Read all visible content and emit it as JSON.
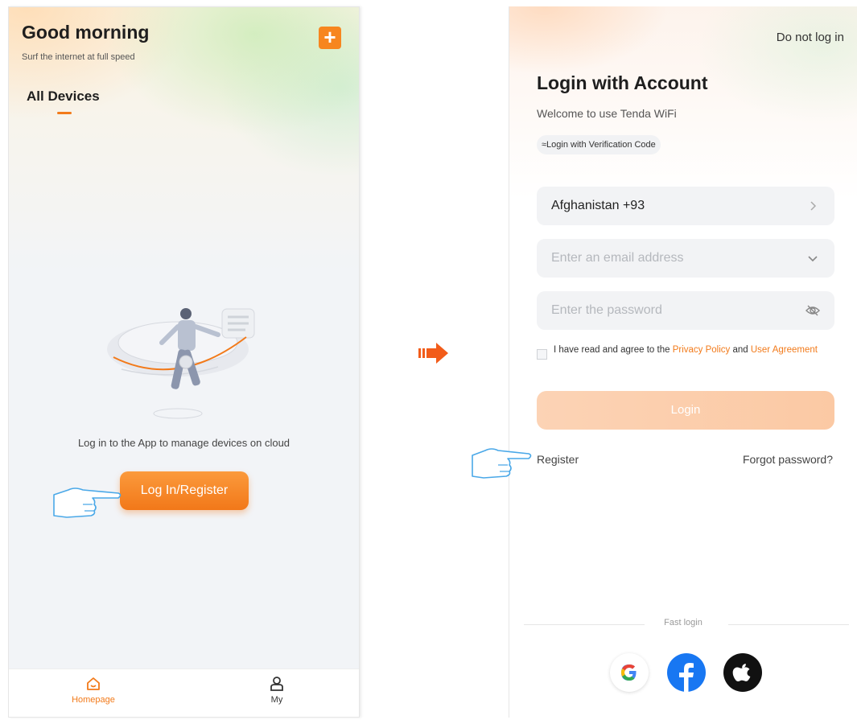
{
  "home": {
    "greeting": "Good morning",
    "subtitle": "Surf the internet at full speed",
    "add_icon": "plus-icon",
    "tab_label": "All Devices",
    "empty_message": "Log in to the App to manage devices on cloud",
    "login_register_label": "Log In/Register",
    "nav": [
      {
        "label": "Homepage",
        "icon": "home-icon",
        "active": true
      },
      {
        "label": "My",
        "icon": "user-icon",
        "active": false
      }
    ]
  },
  "login": {
    "skip_label": "Do not log in",
    "title": "Login with Account",
    "welcome": "Welcome to use Tenda WiFi",
    "switch_mode_label": "≈Login with Verification Code",
    "country_value": "Afghanistan +93",
    "email_placeholder": "Enter an email address",
    "password_placeholder": "Enter the password",
    "agree_prefix": "I have read and agree to the ",
    "privacy_link": "Privacy Policy",
    "agree_and": " and ",
    "user_agreement_link": "User Agreement",
    "login_label": "Login",
    "register_label": "Register",
    "forgot_label": "Forgot password?",
    "fast_login_label": "Fast login",
    "social": [
      "google-icon",
      "facebook-icon",
      "apple-icon"
    ]
  },
  "colors": {
    "accent": "#f27a1a",
    "login_button_disabled": "#fbc9a4",
    "facebook": "#1877f2",
    "apple": "#111111"
  }
}
